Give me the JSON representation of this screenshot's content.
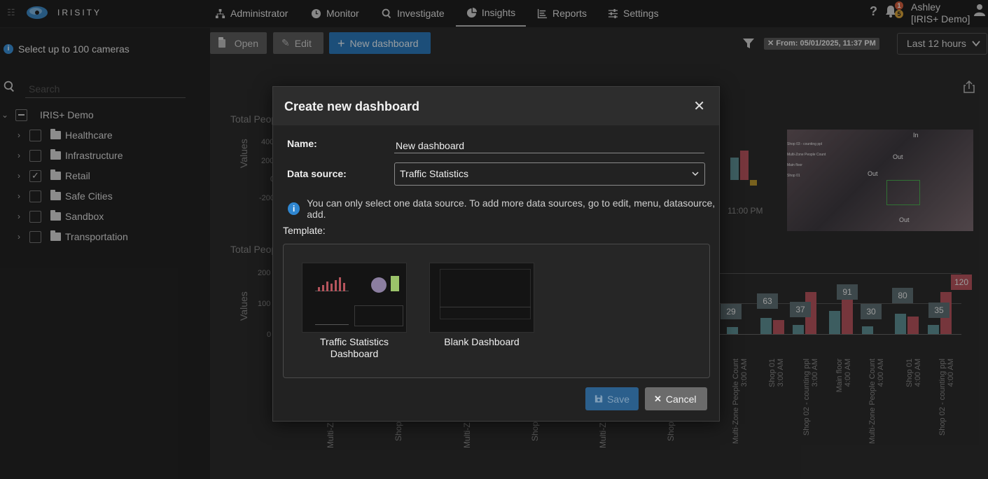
{
  "brand": {
    "name": "IRISITY"
  },
  "nav": [
    {
      "label": "Administrator",
      "icon": "sitemap-icon"
    },
    {
      "label": "Monitor",
      "icon": "clock-icon"
    },
    {
      "label": "Investigate",
      "icon": "search-icon"
    },
    {
      "label": "Insights",
      "icon": "pie-chart-icon",
      "active": true
    },
    {
      "label": "Reports",
      "icon": "report-icon"
    },
    {
      "label": "Settings",
      "icon": "sliders-icon"
    }
  ],
  "user": {
    "name": "Ashley",
    "org": "[IRIS+ Demo]",
    "notif_a": "1",
    "notif_b": "5"
  },
  "sidebar": {
    "hint": "Select up to 100 cameras",
    "search_placeholder": "Search",
    "root": "IRIS+ Demo",
    "items": [
      {
        "label": "Healthcare",
        "checked": false
      },
      {
        "label": "Infrastructure",
        "checked": false
      },
      {
        "label": "Retail",
        "checked": true
      },
      {
        "label": "Safe Cities",
        "checked": false
      },
      {
        "label": "Sandbox",
        "checked": false
      },
      {
        "label": "Transportation",
        "checked": false
      }
    ]
  },
  "toolbar": {
    "open_label": "Open",
    "edit_label": "Edit",
    "new_label": "New dashboard",
    "filter_chip": "From: 05/01/2025, 11:37 PM",
    "range_label": "Last 12 hours"
  },
  "background": {
    "panel_title_1": "Total Peop",
    "panel_title_2": "Total Peop",
    "values_label": "Values",
    "time_label": "11:00 PM",
    "y_ticks_top": [
      "400",
      "200",
      "0",
      "-200"
    ],
    "y_ticks_bottom": [
      "200",
      "100",
      "0"
    ],
    "bar_labels": [
      "29",
      "63",
      "37",
      "91",
      "30",
      "80",
      "35",
      "120"
    ],
    "x_labels": [
      "Multi-Zone People Count 3:00 AM",
      "Shop 01 3:00 AM",
      "Shop 02 - counting ppl 3:00 AM",
      "Main floor 4:00 AM",
      "Multi-Zone People Count 4:00 AM",
      "Shop 01 4:00 AM",
      "Shop 02 - counting ppl 4:00 AM"
    ],
    "cut_labels": [
      "Multi-Z",
      "Shop",
      "Multi-Z",
      "Shop",
      "Multi-Z",
      "Shop"
    ],
    "camera_in": "In",
    "camera_out": "Out",
    "camera_legend": [
      "Shop 03 - counting ppl",
      "Multi-Zone People Count",
      "Main floor",
      "Shop 01"
    ]
  },
  "modal": {
    "title": "Create new dashboard",
    "name_label": "Name:",
    "name_value": "New dashboard",
    "source_label": "Data source:",
    "source_value": "Traffic Statistics",
    "note": "You can only select one data source. To add more data sources, go to edit, menu, datasource, add.",
    "template_label": "Template:",
    "templates": [
      {
        "label": "Traffic Statistics Dashboard"
      },
      {
        "label": "Blank Dashboard"
      }
    ],
    "save_label": "Save",
    "cancel_label": "Cancel"
  },
  "colors": {
    "accent": "#2c79ba",
    "bar_teal": "#5f8f94",
    "bar_red": "#b5545c"
  }
}
